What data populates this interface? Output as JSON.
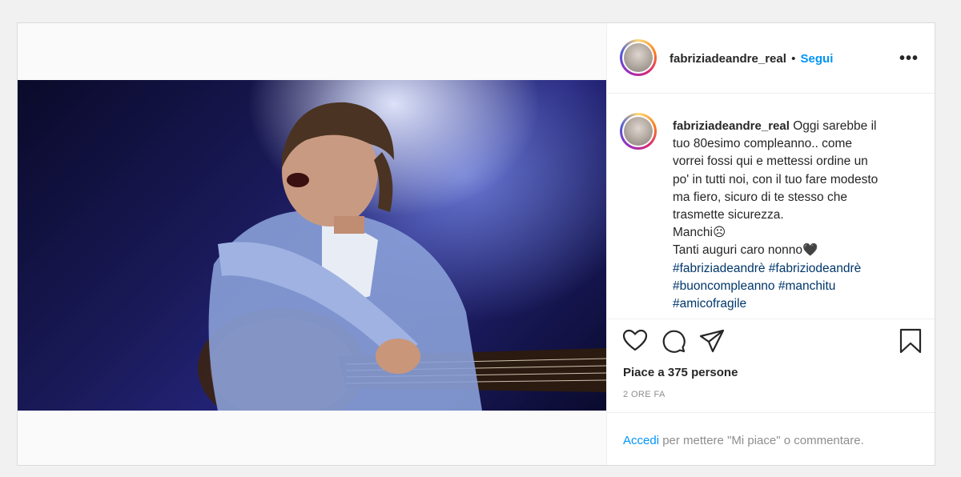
{
  "header": {
    "username": "fabriziadeandre_real",
    "separator": "•",
    "follow_label": "Segui",
    "more_label": "•••"
  },
  "photo": {
    "description": "concert-photo-guitarist"
  },
  "caption": {
    "username": "fabriziadeandre_real",
    "lines": [
      "Oggi sarebbe il",
      "tuo 80esimo compleanno.. come",
      "vorrei fossi qui e mettessi ordine un",
      "po' in tutti noi, con il tuo fare modesto",
      "ma fiero, sicuro di te stesso che",
      "trasmette sicurezza.",
      "Manchi☹",
      "Tanti auguri caro nonno🖤"
    ],
    "hashtags": [
      [
        "#fabriziadeandrè",
        "#fabriziodeandrè"
      ],
      [
        "#buoncompleanno",
        "#manchitu"
      ],
      [
        "#amicofragile"
      ]
    ]
  },
  "actions": {
    "like_icon": "heart-icon",
    "comment_icon": "comment-icon",
    "share_icon": "send-icon",
    "save_icon": "bookmark-icon"
  },
  "likes_text": "Piace a 375 persone",
  "time_text": "2 ORE FA",
  "footer": {
    "login_link": "Accedi",
    "login_rest": " per mettere \"Mi piace\" o commentare."
  },
  "colors": {
    "accent": "#0095f6",
    "hashtag": "#00376b",
    "muted": "#8e8e8e"
  }
}
